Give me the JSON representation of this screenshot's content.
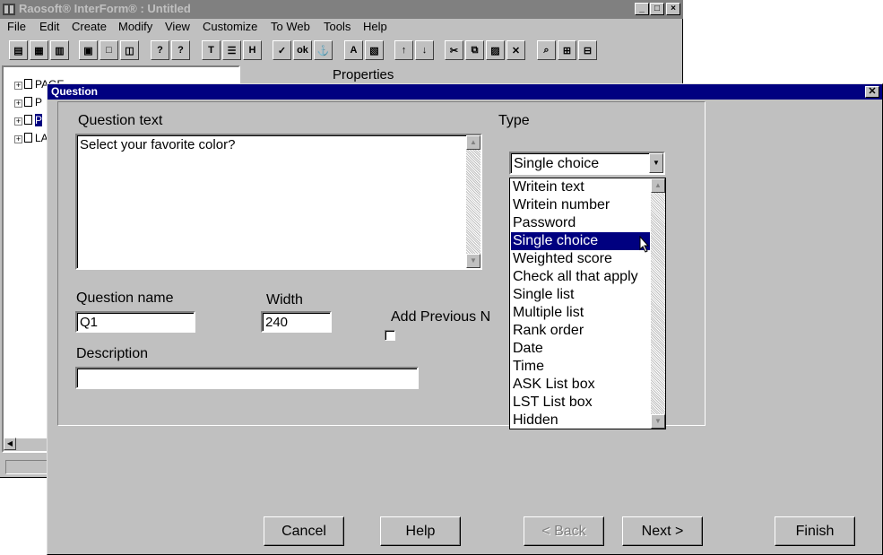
{
  "app": {
    "title": "Raosoft® InterForm® : Untitled",
    "menu": [
      "File",
      "Edit",
      "Create",
      "Modify",
      "View",
      "Customize",
      "To Web",
      "Tools",
      "Help"
    ],
    "tree_items": [
      "PAGE",
      "P",
      "P",
      "LA"
    ],
    "properties_title": "Properties"
  },
  "dialog": {
    "title": "Question",
    "question_text_label": "Question text",
    "question_text_value": "Select your favorite color?",
    "type_label": "Type",
    "type_value": "Single choice",
    "type_options": [
      "Writein text",
      "Writein number",
      "Password",
      "Single choice",
      "Weighted score",
      "Check all that apply",
      "Single list",
      "Multiple list",
      "Rank order",
      "Date",
      "Time",
      "ASK List box",
      "LST List box",
      "Hidden"
    ],
    "selected_option_index": 3,
    "question_name_label": "Question name",
    "question_name_value": "Q1",
    "width_label": "Width",
    "width_value": "240",
    "add_previous_label": "Add Previous N",
    "description_label": "Description",
    "description_value": "",
    "buttons": {
      "cancel": "Cancel",
      "help": "Help",
      "back": "< Back",
      "next": "Next >",
      "finish": "Finish"
    }
  },
  "colors": {
    "dialog_bg": "#c0c0c0",
    "title_active": "#000080",
    "title_inactive": "#808080",
    "selection": "#000080"
  }
}
